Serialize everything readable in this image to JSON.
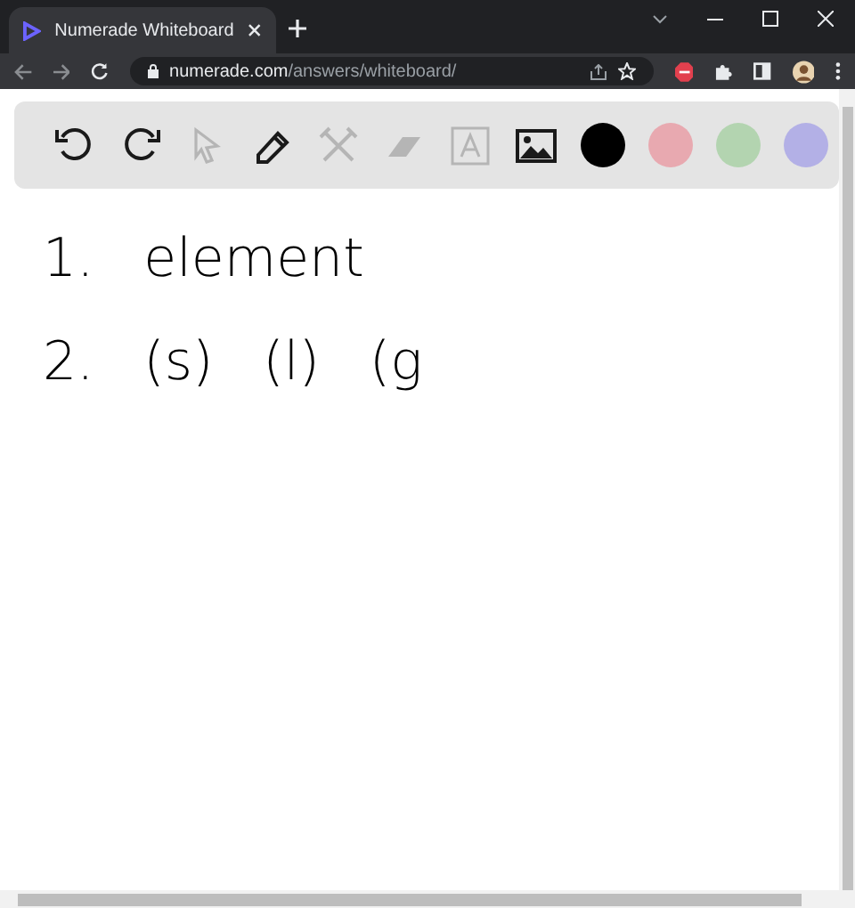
{
  "browser": {
    "tab_title": "Numerade Whiteboard",
    "url_host": "numerade.com",
    "url_path": "/answers/whiteboard/"
  },
  "toolbar": {
    "tools": [
      {
        "kind": "undo",
        "disabled": false
      },
      {
        "kind": "redo",
        "disabled": false
      },
      {
        "kind": "pointer",
        "disabled": true
      },
      {
        "kind": "pen",
        "disabled": false
      },
      {
        "kind": "tools",
        "disabled": true
      },
      {
        "kind": "eraser",
        "disabled": true
      },
      {
        "kind": "text",
        "disabled": true
      },
      {
        "kind": "image",
        "disabled": false
      }
    ],
    "colors": [
      {
        "color": "#000000"
      },
      {
        "color": "#e8a9b0"
      },
      {
        "color": "#b3d4b0"
      },
      {
        "color": "#b3b0e6"
      }
    ]
  },
  "whiteboard": {
    "lines": [
      [
        "1.",
        "element"
      ],
      [
        "2.",
        "(s)",
        "(l)",
        "(g"
      ]
    ]
  }
}
